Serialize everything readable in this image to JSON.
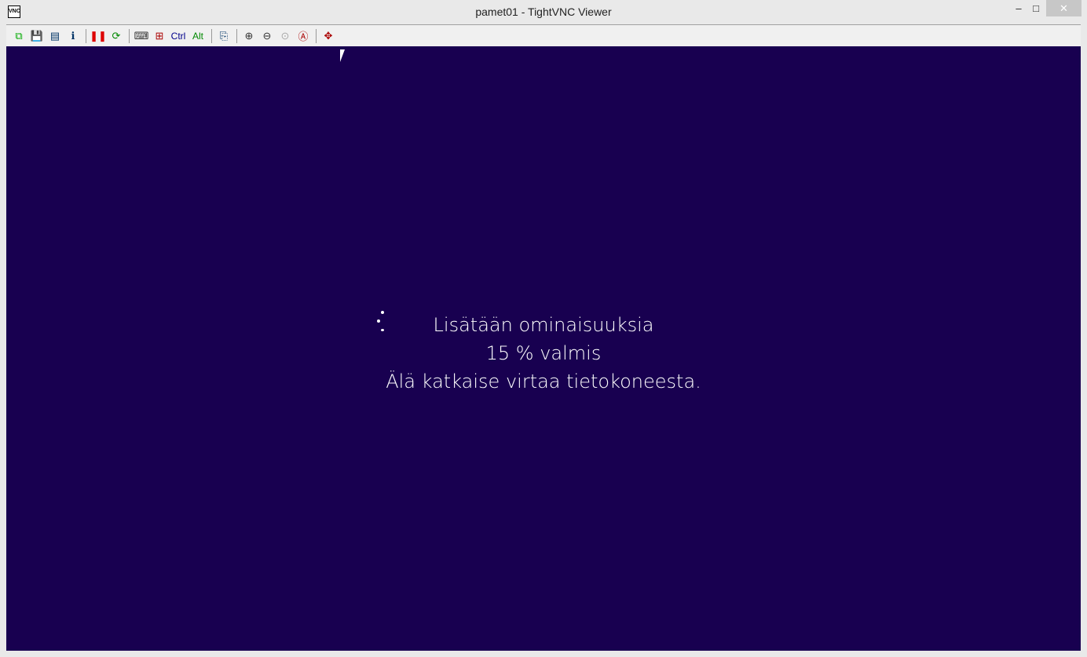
{
  "window": {
    "title": "pamet01 - TightVNC Viewer",
    "app_icon": "VNC",
    "minimize": "–",
    "maximize": "□",
    "close": "✕"
  },
  "toolbar": {
    "items": [
      {
        "name": "new-connection-icon",
        "glyph": "⧉",
        "color": "#0a0"
      },
      {
        "name": "save-icon",
        "glyph": "💾",
        "color": "#660"
      },
      {
        "name": "options-icon",
        "glyph": "▤",
        "color": "#036"
      },
      {
        "name": "info-icon",
        "glyph": "ℹ",
        "color": "#036"
      },
      {
        "sep": true
      },
      {
        "name": "pause-icon",
        "glyph": "❚❚",
        "color": "#d00"
      },
      {
        "name": "refresh-icon",
        "glyph": "⟳",
        "color": "#080"
      },
      {
        "sep": true
      },
      {
        "name": "ctrl-alt-del-icon",
        "glyph": "⌨",
        "color": "#333"
      },
      {
        "name": "win-key-icon",
        "glyph": "⊞",
        "color": "#a00"
      },
      {
        "name": "ctrl-button",
        "glyph": "Ctrl",
        "color": "#00008b"
      },
      {
        "name": "alt-button",
        "glyph": "Alt",
        "color": "#080"
      },
      {
        "sep": true
      },
      {
        "name": "clipboard-icon",
        "glyph": "⎘",
        "color": "#036"
      },
      {
        "sep": true
      },
      {
        "name": "zoom-in-icon",
        "glyph": "⊕",
        "color": "#333"
      },
      {
        "name": "zoom-out-icon",
        "glyph": "⊖",
        "color": "#333"
      },
      {
        "name": "zoom-100-icon",
        "glyph": "⊙",
        "color": "#aaa"
      },
      {
        "name": "zoom-auto-icon",
        "glyph": "Ⓐ",
        "color": "#a00"
      },
      {
        "sep": true
      },
      {
        "name": "fullscreen-icon",
        "glyph": "✥",
        "color": "#a00"
      }
    ]
  },
  "screen": {
    "line1": "Lisätään ominaisuuksia",
    "line2": "15 % valmis",
    "line3": "Älä katkaise virtaa tietokoneesta.",
    "background": "#180050"
  }
}
